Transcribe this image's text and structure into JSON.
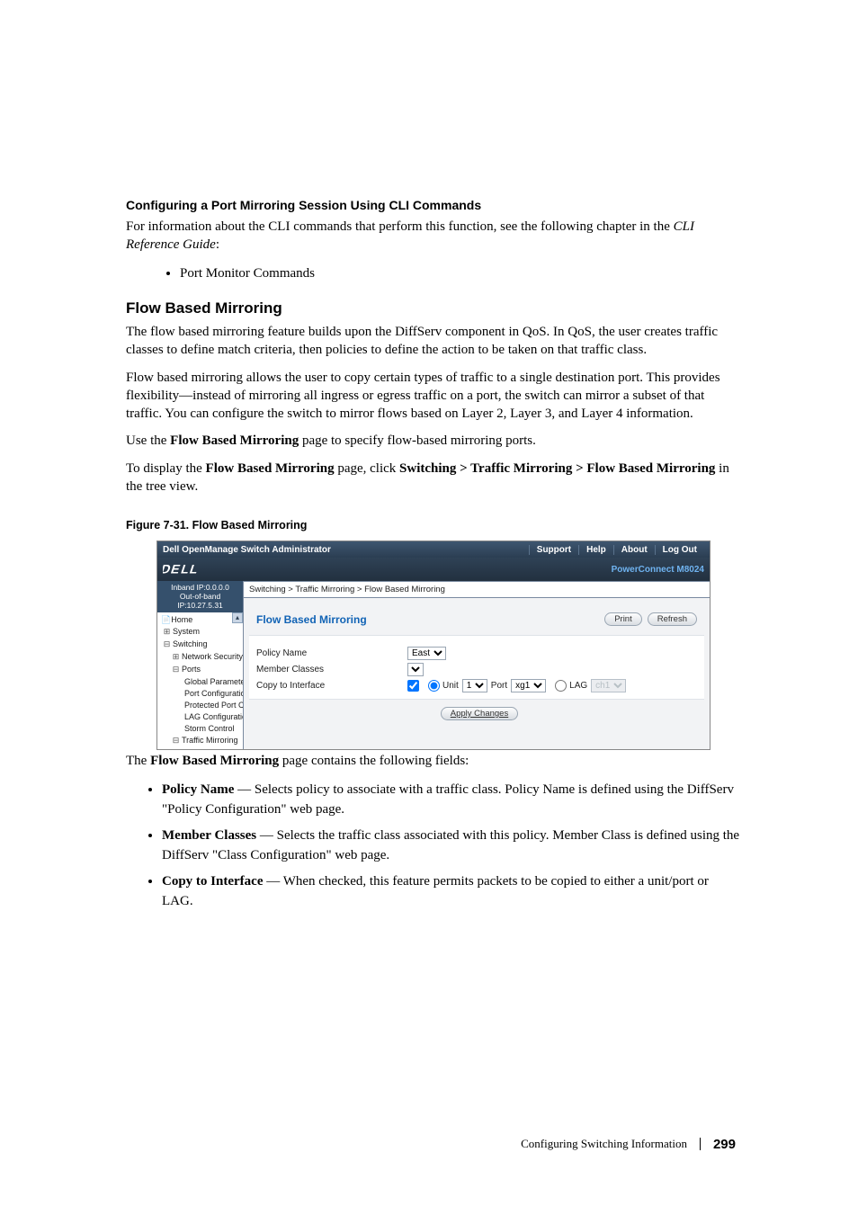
{
  "section1": {
    "heading": "Configuring a Port Mirroring Session Using CLI Commands",
    "p_a": "For information about the CLI commands that perform this function, see the following chapter in the ",
    "p_ref": "CLI Reference Guide",
    "p_b": ":",
    "bullets": [
      "Port Monitor Commands"
    ]
  },
  "section2": {
    "heading": "Flow Based Mirroring",
    "p1": "The flow based mirroring feature builds upon the DiffServ component in QoS. In QoS, the user creates traffic classes to define match criteria, then policies to define the action to be taken on that traffic class.",
    "p2": "Flow based mirroring allows the user to copy certain types of traffic to a single destination port. This provides flexibility—instead of mirroring all ingress or egress traffic on a port, the switch can mirror a subset of that traffic. You can configure the switch to mirror flows based on Layer 2, Layer 3, and Layer 4 information.",
    "p3_a": "Use the ",
    "p3_b": "Flow Based Mirroring",
    "p3_c": " page to specify flow-based mirroring ports.",
    "p4_a": "To display the ",
    "p4_b": "Flow Based Mirroring",
    "p4_c": " page, click ",
    "p4_d": "Switching > Traffic Mirroring > Flow Based Mirroring",
    "p4_e": " in the tree view."
  },
  "figure": {
    "caption": "Figure 7-31.    Flow Based Mirroring"
  },
  "screenshot": {
    "topbar_title": "Dell OpenManage Switch Administrator",
    "links": {
      "support": "Support",
      "help": "Help",
      "about": "About",
      "logout": "Log Out"
    },
    "product": "PowerConnect M8024",
    "ip_line1": "Inband IP:0.0.0.0",
    "ip_line2": "Out-of-band IP:10.27.5.31",
    "tree": {
      "home": "Home",
      "system": "System",
      "switching": "Switching",
      "netsec": "Network Security",
      "ports": "Ports",
      "gparam": "Global Paramete",
      "pconf": "Port Configuratio",
      "pport": "Protected Port C",
      "lag": "LAG Configuratio",
      "storm": "Storm Control",
      "tmirror": "Traffic Mirroring"
    },
    "breadcrumb": "Switching > Traffic Mirroring > Flow Based Mirroring",
    "panel": {
      "title": "Flow Based Mirroring",
      "print": "Print",
      "refresh": "Refresh",
      "policy_label": "Policy Name",
      "policy_value": "East",
      "member_label": "Member Classes",
      "copy_label": "Copy to Interface",
      "unit_text": "Unit",
      "unit_val": "1",
      "port_text": "Port",
      "port_val": "xg1",
      "lag_text": "LAG",
      "lag_val": "ch1",
      "apply": "Apply Changes"
    }
  },
  "after_fig": {
    "intro_a": "The ",
    "intro_b": "Flow Based Mirroring",
    "intro_c": " page contains the following fields:",
    "items": [
      {
        "term": "Policy Name",
        "desc": " — Selects policy to associate with a traffic class. Policy Name is defined using the DiffServ \"Policy Configuration\" web page."
      },
      {
        "term": "Member Classes",
        "desc": " — Selects the traffic class associated with this policy. Member Class is defined using the DiffServ \"Class Configuration\" web page."
      },
      {
        "term": "Copy to Interface",
        "desc": " — When checked, this feature permits packets to be copied to either a unit/port or LAG."
      }
    ]
  },
  "footer": {
    "text": "Configuring Switching Information",
    "page": "299"
  }
}
